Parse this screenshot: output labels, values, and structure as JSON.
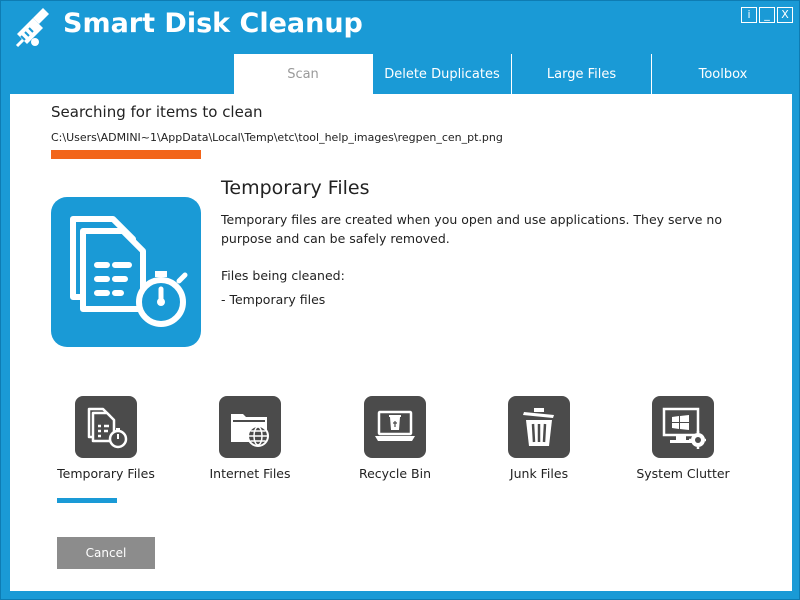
{
  "app": {
    "title": "Smart Disk Cleanup",
    "controls": {
      "info": "i",
      "minimize": "_",
      "close": "X"
    }
  },
  "tabs": [
    {
      "label": "Scan",
      "active": true
    },
    {
      "label": "Delete Duplicates",
      "active": false
    },
    {
      "label": "Large Files",
      "active": false
    },
    {
      "label": "Toolbox",
      "active": false
    }
  ],
  "scan": {
    "heading": "Searching for items to clean",
    "current_path": "C:\\Users\\ADMINI~1\\AppData\\Local\\Temp\\etc\\tool_help_images\\regpen_cen_pt.png",
    "progress_color": "#f2651a"
  },
  "detail": {
    "icon": "temporary-files-icon",
    "title": "Temporary Files",
    "description": "Temporary files are created when you open and use applications. They serve no purpose and can be safely removed.",
    "files_label": "Files being cleaned:",
    "files_item": "- Temporary files"
  },
  "categories": [
    {
      "label": "Temporary Files",
      "icon": "temporary-files-icon",
      "active": true
    },
    {
      "label": "Internet Files",
      "icon": "internet-files-icon",
      "active": false
    },
    {
      "label": "Recycle Bin",
      "icon": "recycle-bin-icon",
      "active": false
    },
    {
      "label": "Junk Files",
      "icon": "junk-files-icon",
      "active": false
    },
    {
      "label": "System Clutter",
      "icon": "system-clutter-icon",
      "active": false
    }
  ],
  "actions": {
    "cancel_label": "Cancel"
  },
  "colors": {
    "accent": "#1a9ad6",
    "progress": "#f2651a",
    "tile": "#4b4b4b",
    "button": "#8c8c8c"
  }
}
